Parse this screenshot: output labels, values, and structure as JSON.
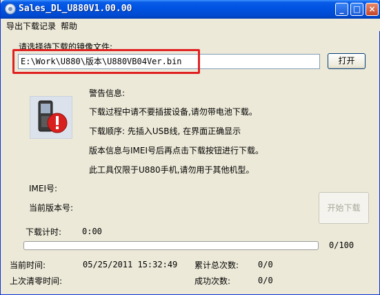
{
  "window": {
    "title": "Sales_DL_U880V1.00.00"
  },
  "title_buttons": {
    "minimize": "_",
    "maximize": "□",
    "close": "×"
  },
  "menu": [
    "导出下载记录",
    "帮助"
  ],
  "file_select": {
    "prompt": "请选择待下载的镜像文件:",
    "path": "E:\\Work\\U880\\版本\\U880VB04Ver.bin",
    "open_label": "打开"
  },
  "warning": {
    "heading": "警告信息:",
    "lines": [
      "下载过程中请不要插拔设备,请勿带电池下载。",
      "下载顺序: 先插入USB线, 在界面正确显示",
      "版本信息与IMEI号后再点击下载按钮进行下载。",
      "此工具仅限于U880手机,请勿用于其他机型。"
    ]
  },
  "device": {
    "imei_label": "IMEI号:",
    "version_label": "当前版本号:"
  },
  "start_label": "开始下载",
  "timer": {
    "label": "下载计时:",
    "value": "0:00"
  },
  "progress": {
    "fraction": 0,
    "text": "0/100"
  },
  "status": {
    "current_time_label": "当前时间:",
    "current_time_value": "05/25/2011 15:32:49",
    "total_label": "累计总次数:",
    "total_value": "0/0",
    "last_reset_label": "上次清零时间:",
    "success_label": "成功次数:",
    "success_value": "0/0"
  },
  "icons": {
    "app": "app-icon",
    "warning": "phone-warning-icon"
  },
  "colors": {
    "title_bar": "#0054e3",
    "highlight": "#e02020",
    "window_bg": "#ece9d8"
  }
}
